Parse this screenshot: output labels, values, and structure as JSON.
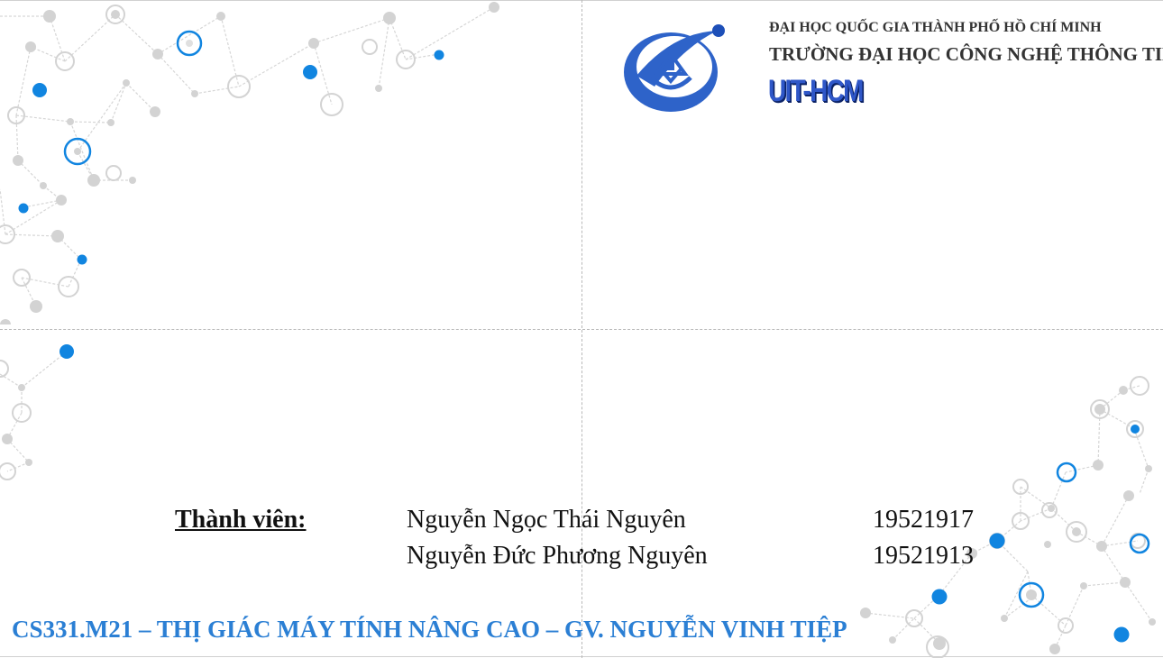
{
  "header": {
    "university_line1": "ĐẠI HỌC QUỐC GIA THÀNH PHỐ HỒ CHÍ MINH",
    "university_line2": "TRƯỜNG ĐẠI HỌC CÔNG NGHỆ THÔNG TIN",
    "abbreviation": "UIT-HCM"
  },
  "members": {
    "label": "Thành viên:",
    "list": [
      {
        "name": "Nguyễn Ngọc Thái Nguyên",
        "id": "19521917"
      },
      {
        "name": "Nguyễn Đức Phương Nguyên",
        "id": "19521913"
      }
    ]
  },
  "footer": {
    "course_line": "CS331.M21 – THỊ GIÁC MÁY TÍNH NÂNG CAO – GV. NGUYỄN VINH TIỆP"
  },
  "colors": {
    "accent_blue": "#2b7fd4",
    "network_blue": "#1185e0",
    "network_gray": "#d3d3d3",
    "logo_blue": "#2f57c8"
  },
  "icons": {
    "logo": "uit-logo-icon",
    "decoration": "network-nodes-decoration"
  }
}
